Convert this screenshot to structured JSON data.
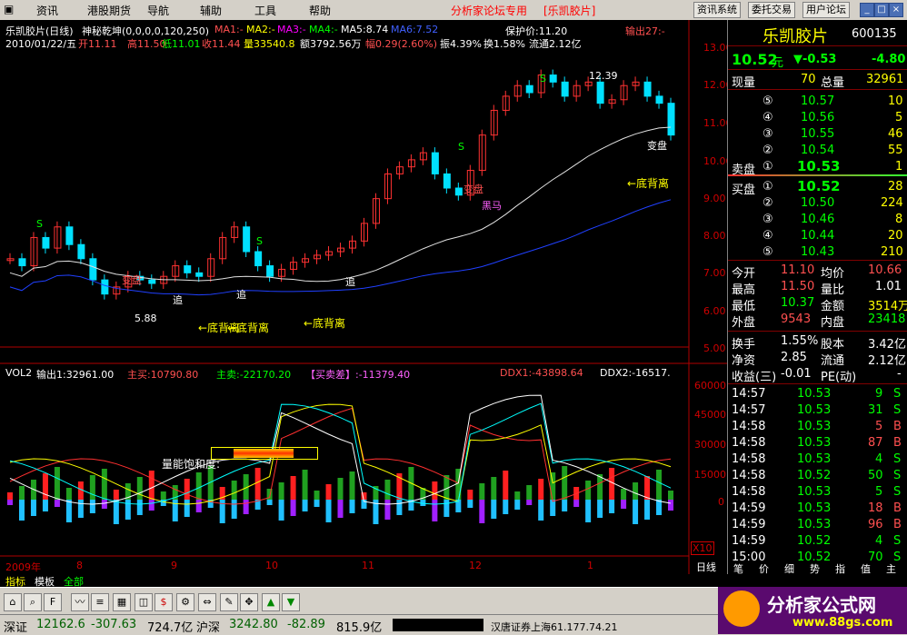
{
  "menu": {
    "items": [
      "资讯",
      "港股期货",
      "导航",
      "辅助",
      "工具",
      "帮助"
    ],
    "title": "分析家论坛专用",
    "title_bracket": "[乐凯胶片]",
    "buttons": [
      "资讯系统",
      "委托交易",
      "用户论坛"
    ],
    "win_min": "_",
    "win_max": "□",
    "win_close": "×"
  },
  "chart_header": {
    "name": "乐凯胶片(日线)",
    "indicator": "神秘乾坤(0,0,0,0,120,250)",
    "ma1": "MA1:-",
    "ma2": "MA2:-",
    "ma3": "MA3:-",
    "ma4": "MA4:-",
    "ma5": "MA5:8.74",
    "ma6": "MA6:7.52",
    "baohu": "保护价:11.20",
    "shuchu": "输出27:-",
    "date": "2010/01/22/五",
    "open": "开11.11",
    "high": "高11.50",
    "low": "低11.01",
    "close": "收11.44",
    "vol": "量33540.8",
    "amount": "额3792.56万",
    "fu": "幅0.29(2.60%)",
    "zhen": "振4.39%",
    "huan": "换1.58%",
    "liutong": "流通2.12亿"
  },
  "price_axis": [
    "13.00",
    "12.00",
    "11.00",
    "10.00",
    "9.00",
    "8.00",
    "7.00",
    "6.00",
    "5.00"
  ],
  "vol_axis": [
    "60000",
    "45000",
    "30000",
    "15000",
    "0"
  ],
  "x_labels": [
    "2009年",
    "8",
    "9",
    "10",
    "11",
    "12",
    "1"
  ],
  "price_annotations": {
    "high_label": "12.39",
    "low_label": "5.88",
    "dibeili1": "←底背离",
    "dibeili2": "←底背离",
    "dibeili3": "←底背离",
    "dibeili4": "←底背离",
    "bianpan1": "变盘",
    "bianpan2": "变盘",
    "bianpan3": "变盘",
    "heima": "黑马",
    "zhui1": "追",
    "zhui2": "追",
    "zhui3": "追",
    "s_mark": "S"
  },
  "vol_header": {
    "name": "VOL2",
    "shuchu": "输出1:32961.00",
    "zhumai": "主买:10790.80",
    "zhumai2": "主卖:-22170.20",
    "maimai": "【买卖差】:-11379.40",
    "ddx1": "DDX1:-43898.64",
    "ddx2": "DDX2:-16517."
  },
  "vol_annotation": "量能饱和度:",
  "x10": "X10",
  "rixian": "日线",
  "panel": {
    "stock_name": "乐凯胶片",
    "stock_code": "600135",
    "price": "10.52",
    "unit": "元",
    "change": "▼-0.53",
    "change_pct": "-4.80",
    "xianliang_label": "现量",
    "xianliang": "70",
    "zongliang_label": "总量",
    "zongliang": "32961",
    "sell": [
      {
        "idx": "⑤",
        "price": "10.57",
        "vol": "10"
      },
      {
        "idx": "④",
        "price": "10.56",
        "vol": "5"
      },
      {
        "idx": "③",
        "price": "10.55",
        "vol": "46"
      },
      {
        "idx": "②",
        "price": "10.54",
        "vol": "55"
      }
    ],
    "maipan_label": "卖盘",
    "maipan_idx": "①",
    "maipan_price": "10.53",
    "maipan_vol": "1",
    "buypan_label": "买盘",
    "buypan_idx": "①",
    "buypan_price": "10.52",
    "buypan_vol": "28",
    "buy": [
      {
        "idx": "②",
        "price": "10.50",
        "vol": "224"
      },
      {
        "idx": "③",
        "price": "10.46",
        "vol": "8"
      },
      {
        "idx": "④",
        "price": "10.44",
        "vol": "20"
      },
      {
        "idx": "⑤",
        "price": "10.43",
        "vol": "210"
      }
    ],
    "stats": [
      {
        "l1": "今开",
        "v1": "11.10",
        "l2": "均价",
        "v2": "10.66"
      },
      {
        "l1": "最高",
        "v1": "11.50",
        "l2": "量比",
        "v2": "1.01"
      },
      {
        "l1": "最低",
        "v1": "10.37",
        "l2": "金额",
        "v2": "3514万"
      },
      {
        "l1": "外盘",
        "v1": "9543",
        "l2": "内盘",
        "v2": "23418"
      }
    ],
    "stats2": [
      {
        "l1": "换手",
        "v1": "1.55%",
        "l2": "股本",
        "v2": "3.42亿"
      },
      {
        "l1": "净资",
        "v1": "2.85",
        "l2": "流通",
        "v2": "2.12亿"
      },
      {
        "l1": "收益(三)",
        "v1": "-0.01",
        "l2": "PE(动)",
        "v2": "-"
      }
    ],
    "ticks": [
      {
        "t": "14:57",
        "p": "10.53",
        "v": "9",
        "s": "S"
      },
      {
        "t": "14:57",
        "p": "10.53",
        "v": "31",
        "s": "S"
      },
      {
        "t": "14:58",
        "p": "10.53",
        "v": "5",
        "s": "B"
      },
      {
        "t": "14:58",
        "p": "10.53",
        "v": "87",
        "s": "B"
      },
      {
        "t": "14:58",
        "p": "10.53",
        "v": "4",
        "s": "S"
      },
      {
        "t": "14:58",
        "p": "10.52",
        "v": "50",
        "s": "S"
      },
      {
        "t": "14:58",
        "p": "10.53",
        "v": "5",
        "s": "S"
      },
      {
        "t": "14:59",
        "p": "10.53",
        "v": "18",
        "s": "B"
      },
      {
        "t": "14:59",
        "p": "10.53",
        "v": "96",
        "s": "B"
      },
      {
        "t": "14:59",
        "p": "10.52",
        "v": "4",
        "s": "S"
      },
      {
        "t": "15:00",
        "p": "10.52",
        "v": "70",
        "s": "S"
      }
    ],
    "bottom_tabs": [
      "笔",
      "价",
      "细",
      "势",
      "指",
      "值",
      "主"
    ]
  },
  "tabs": [
    "指标",
    "模板",
    "全部"
  ],
  "status": {
    "sz_label": "深证",
    "sz_val": "12162.6",
    "sz_chg": "-307.63",
    "sz_amt": "724.7亿",
    "hs_label": "沪深",
    "hs_val": "3242.80",
    "hs_chg": "-82.89",
    "hs_amt": "815.9亿",
    "broker": "汉唐证券上海61.177.74.21"
  },
  "logo": {
    "text": "分析家公式网",
    "url_text": "www.88gs.com"
  },
  "colors": {
    "up": "#ff3232",
    "down": "#00d000",
    "yellow": "#ffff00",
    "cyan": "#00ffff",
    "magenta": "#ff00ff"
  },
  "chart_data": {
    "type": "line",
    "series": [
      {
        "values": [
          7.0,
          6.8,
          7.6,
          7.3,
          7.9,
          7.4,
          7.0,
          6.4,
          6.0,
          6.2,
          6.5,
          6.4,
          6.3,
          6.5,
          6.8,
          6.6,
          6.5,
          7.0,
          7.6,
          7.9,
          7.2,
          6.8,
          6.5,
          6.7,
          6.9,
          7.0,
          7.1,
          7.2,
          7.3,
          7.5,
          8.0,
          8.7,
          9.4,
          9.6,
          9.8,
          10.0,
          9.4,
          9.0,
          8.8,
          9.5,
          10.5,
          11.2,
          11.6,
          11.9,
          11.7,
          12.2,
          12.0,
          11.6,
          11.9,
          12.0,
          11.4,
          11.5,
          11.9,
          12.0,
          11.6,
          11.4,
          10.5
        ]
      }
    ],
    "ylim": [
      4.5,
      13.5
    ]
  }
}
